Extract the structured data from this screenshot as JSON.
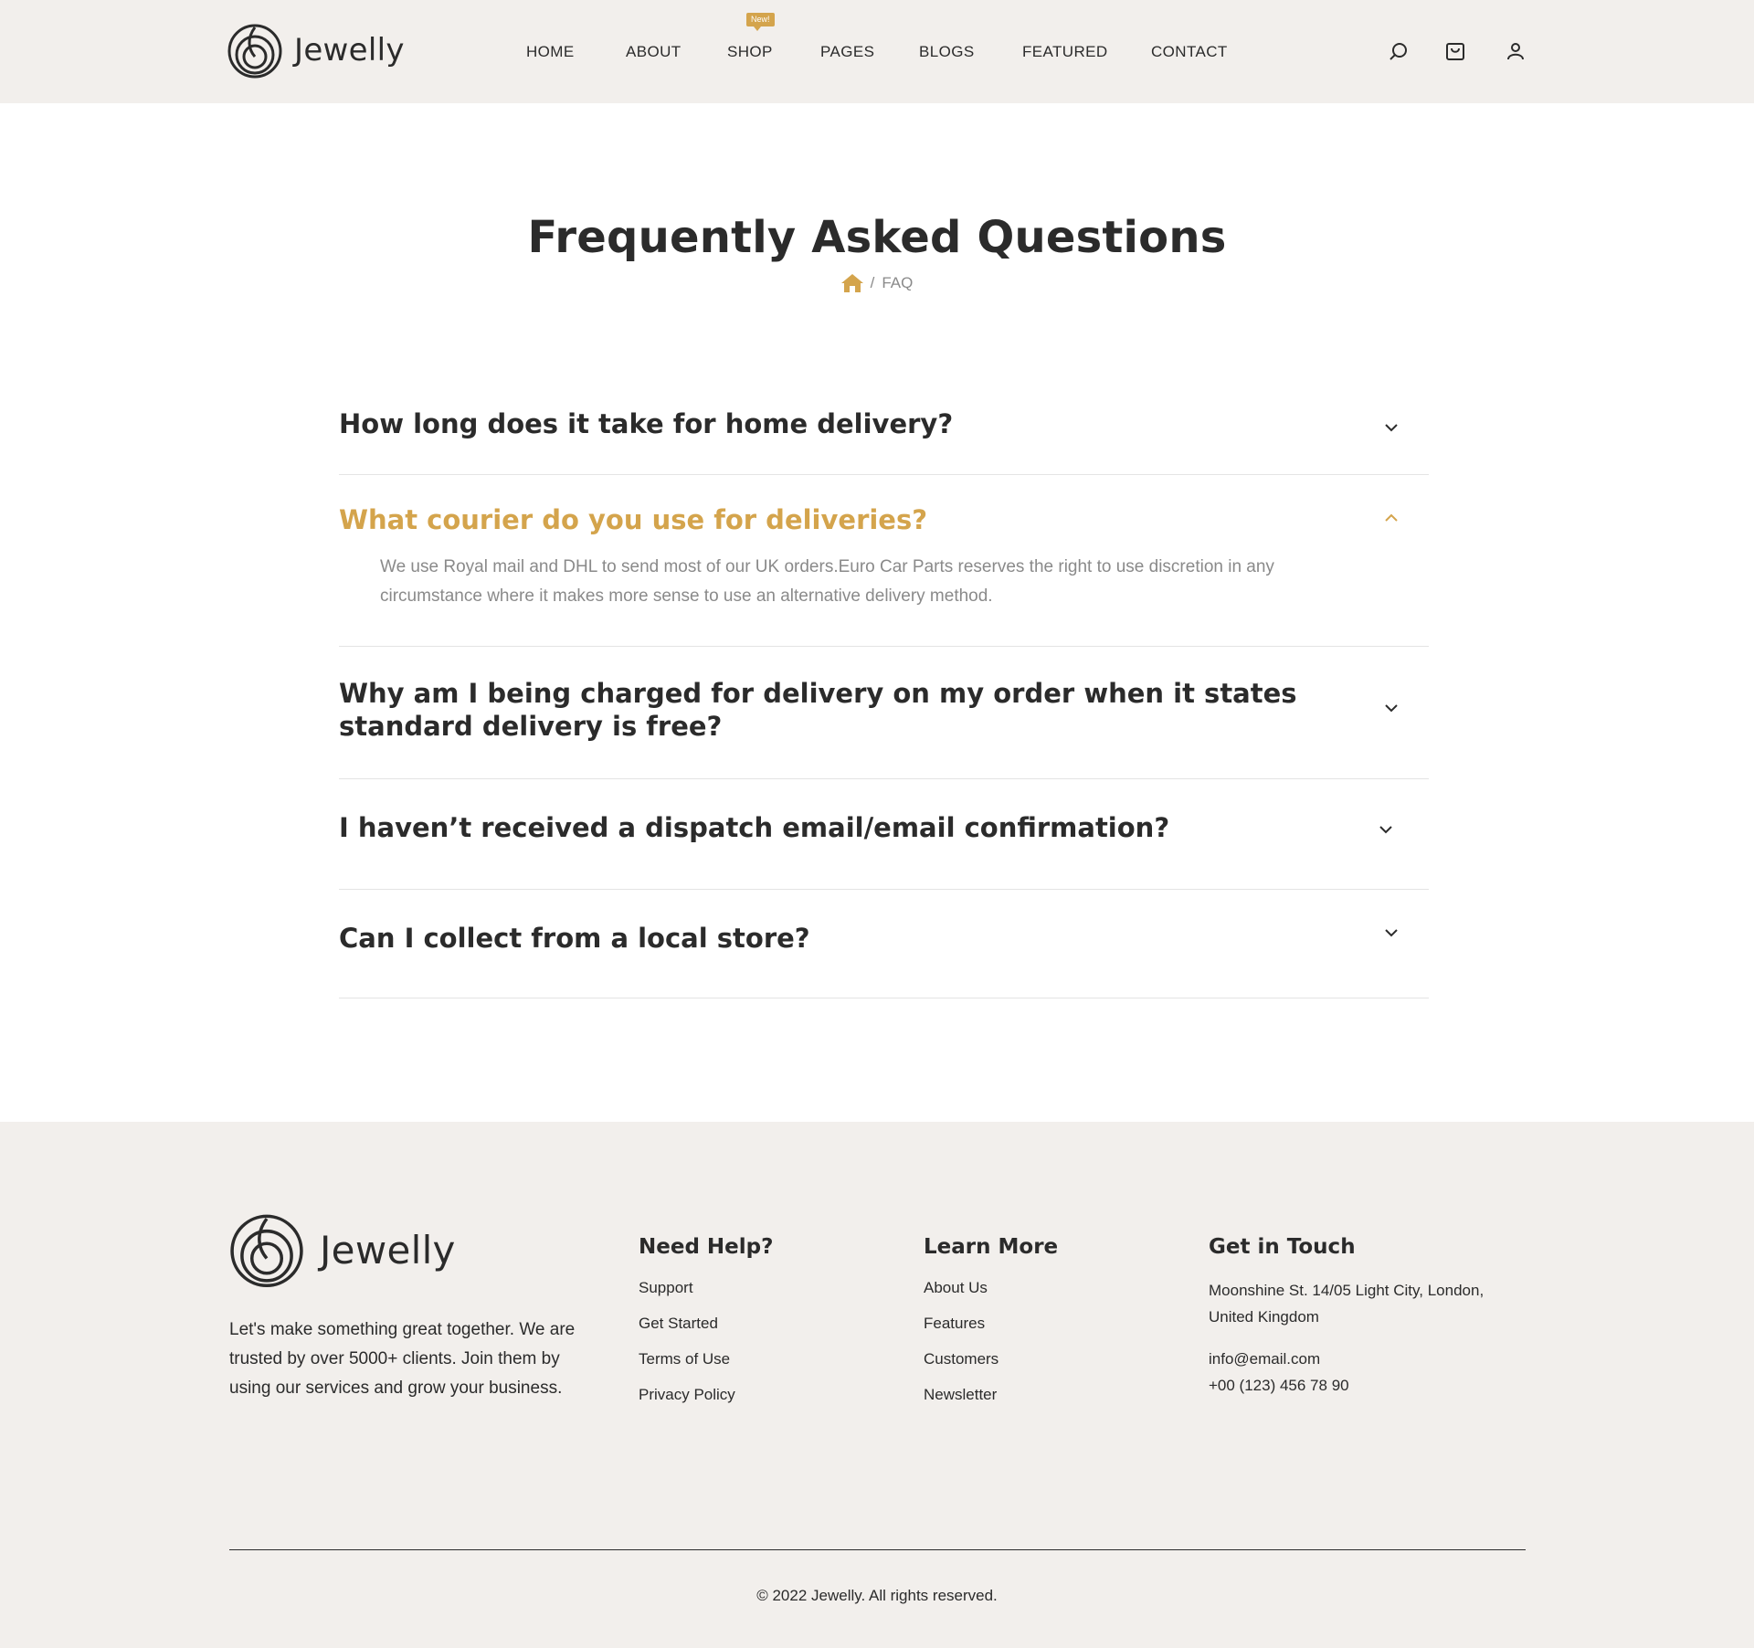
{
  "brand": {
    "name": "Jewelly",
    "accent_color": "#d4a44c",
    "text_color": "#2b2b2b",
    "header_bg": "#f2efec"
  },
  "nav": {
    "items": [
      "HOME",
      "ABOUT",
      "SHOP",
      "PAGES",
      "BLOGS",
      "FEATURED",
      "CONTACT"
    ],
    "badge": "New!"
  },
  "header_icons": [
    "search-icon",
    "cart-icon",
    "user-icon"
  ],
  "hero": {
    "title": "Frequently Asked Questions",
    "breadcrumb_sep": "/",
    "breadcrumb_current": "FAQ"
  },
  "faq": [
    {
      "question": "How long does it take for home delivery?",
      "expanded": false
    },
    {
      "question": "What courier do you use for deliveries?",
      "expanded": true,
      "answer": "We use Royal mail and DHL to send most of our UK orders.Euro Car Parts reserves the right to use discretion in any circumstance where it makes more sense to use an alternative delivery method."
    },
    {
      "question": "Why am I being charged for delivery on my order when it states standard delivery is free?",
      "expanded": false
    },
    {
      "question": "I haven’t received a dispatch email/email confirmation?",
      "expanded": false
    },
    {
      "question": "Can I collect from a local store?",
      "expanded": false
    }
  ],
  "footer": {
    "description": "Let's make something great together. We are trusted by over 5000+ clients. Join them by using our services and grow your business.",
    "need_help": {
      "title": "Need Help?",
      "links": [
        "Support",
        "Get Started",
        "Terms of Use",
        "Privacy Policy"
      ]
    },
    "learn_more": {
      "title": "Learn More",
      "links": [
        "About Us",
        "Features",
        "Customers",
        "Newsletter"
      ]
    },
    "get_in_touch": {
      "title": "Get in Touch",
      "address_line1": "Moonshine St. 14/05 Light City, London,",
      "address_line2": "United Kingdom",
      "email": "info@email.com",
      "phone": "+00 (123) 456 78 90"
    },
    "copyright": "© 2022 Jewelly. All rights reserved."
  }
}
